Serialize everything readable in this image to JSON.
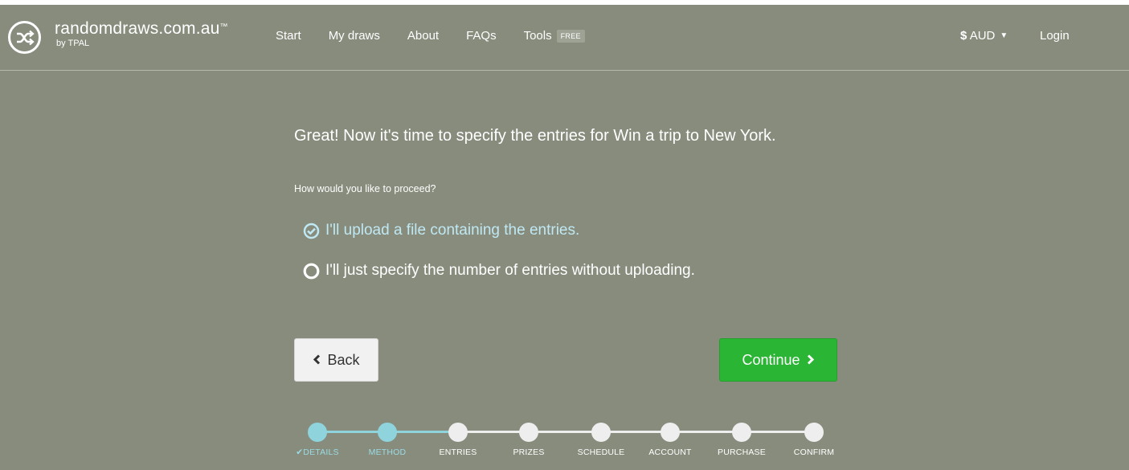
{
  "header": {
    "logo_icon": "shuffle-icon",
    "brand": "randomdraws.com.au",
    "trademark": "™",
    "by_line": "by TPAL",
    "nav": [
      "Start",
      "My draws",
      "About",
      "FAQs",
      "Tools"
    ],
    "tools_badge": "FREE",
    "currency_symbol": "$",
    "currency_code": "AUD",
    "login": "Login"
  },
  "main": {
    "heading": "Great! Now it's time to specify the entries for Win a trip to New York.",
    "subheading": "How would you like to proceed?",
    "options": [
      {
        "label": "I'll upload a file containing the entries.",
        "selected": true
      },
      {
        "label": "I'll just specify the number of entries without uploading.",
        "selected": false
      }
    ],
    "back_label": "Back",
    "continue_label": "Continue"
  },
  "progress": {
    "completed_check": "✔",
    "steps": [
      "DETAILS",
      "METHOD",
      "ENTRIES",
      "PRIZES",
      "SCHEDULE",
      "ACCOUNT",
      "PURCHASE",
      "CONFIRM"
    ],
    "current_index": 1
  },
  "colors": {
    "background": "#878c7d",
    "accent_teal": "#8fd3dc",
    "continue_green": "#2bb534",
    "selected_option": "#bfe8f3"
  }
}
